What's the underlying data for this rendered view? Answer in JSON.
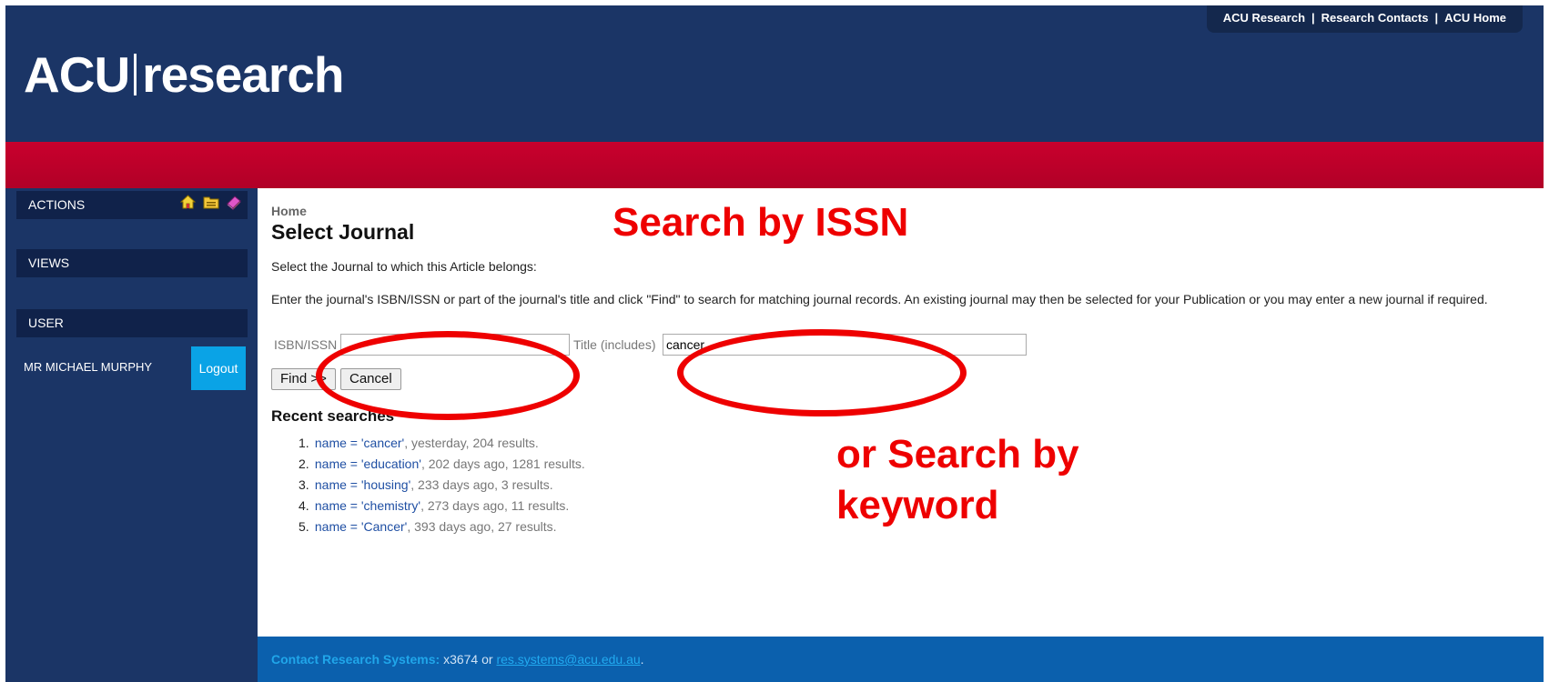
{
  "header": {
    "logo_left": "ACU",
    "logo_right": "research",
    "top_links": [
      "ACU Research",
      "Research Contacts",
      "ACU Home"
    ]
  },
  "sidebar": {
    "actions_label": "ACTIONS",
    "views_label": "VIEWS",
    "user_label": "USER",
    "user_name": "MR MICHAEL MURPHY",
    "logout_label": "Logout",
    "icons": [
      "home-icon",
      "folder-icon",
      "book-icon"
    ]
  },
  "main": {
    "breadcrumb": "Home",
    "title": "Select Journal",
    "intro": "Select the Journal to which this Article belongs:",
    "instructions": "Enter the journal's ISBN/ISSN or part of the journal's title and click \"Find\" to search for matching journal records. An existing journal may then be selected for your Publication or you may enter a new journal if required.",
    "isbn_label": "ISBN/ISSN",
    "isbn_value": "",
    "title_label": "Title (includes)",
    "title_value": "cancer",
    "find_label": "Find >>",
    "cancel_label": "Cancel",
    "recent_heading": "Recent searches",
    "recent": [
      {
        "num": "1.",
        "query": "name = 'cancer'",
        "detail": ", yesterday, 204 results."
      },
      {
        "num": "2.",
        "query": "name = 'education'",
        "detail": ", 202 days ago, 1281 results."
      },
      {
        "num": "3.",
        "query": "name = 'housing'",
        "detail": ", 233 days ago, 3 results."
      },
      {
        "num": "4.",
        "query": "name = 'chemistry'",
        "detail": ", 273 days ago, 11 results."
      },
      {
        "num": "5.",
        "query": "name = 'Cancer'",
        "detail": ", 393 days ago, 27 results."
      }
    ]
  },
  "footer": {
    "contact_label": "Contact Research Systems:",
    "phone": "x3674",
    "or": "or",
    "email": "res.systems@acu.edu.au",
    "period": "."
  },
  "annotations": {
    "issn_callout": "Search by ISSN",
    "keyword_line1": "or Search by",
    "keyword_line2": "keyword",
    "color": "#ee0000"
  }
}
